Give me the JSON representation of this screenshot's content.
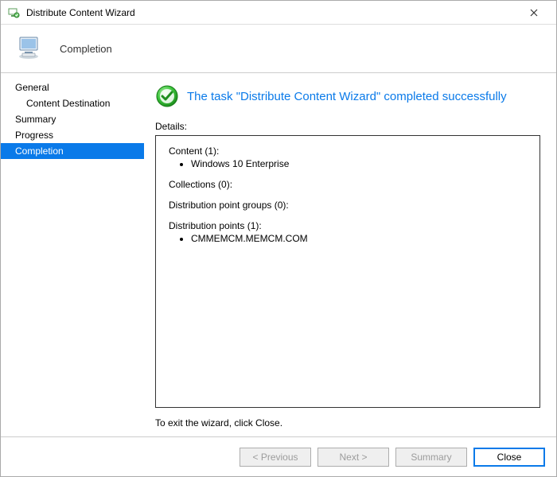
{
  "titlebar": {
    "title": "Distribute Content Wizard"
  },
  "header": {
    "step_title": "Completion"
  },
  "sidebar": {
    "items": [
      {
        "label": "General",
        "sub": false
      },
      {
        "label": "Content Destination",
        "sub": true
      },
      {
        "label": "Summary",
        "sub": false
      },
      {
        "label": "Progress",
        "sub": false
      },
      {
        "label": "Completion",
        "sub": false,
        "selected": true
      }
    ]
  },
  "main": {
    "status_message": "The task \"Distribute Content Wizard\" completed successfully",
    "details_label": "Details:",
    "groups": {
      "content": {
        "title": "Content (1):",
        "items": [
          "Windows 10 Enterprise"
        ]
      },
      "collections": {
        "title": "Collections (0):",
        "items": []
      },
      "dp_groups": {
        "title": "Distribution point groups (0):",
        "items": []
      },
      "dp": {
        "title": "Distribution points (1):",
        "items": [
          "CMMEMCM.MEMCM.COM"
        ]
      }
    },
    "exit_note": "To exit the wizard, click Close."
  },
  "footer": {
    "previous": "< Previous",
    "next": "Next >",
    "summary": "Summary",
    "close": "Close"
  }
}
